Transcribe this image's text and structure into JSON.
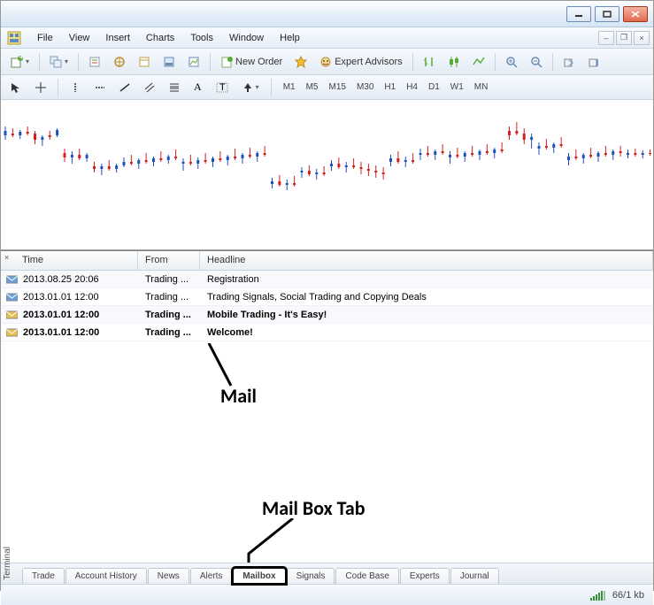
{
  "menu": {
    "file": "File",
    "view": "View",
    "insert": "Insert",
    "charts": "Charts",
    "tools": "Tools",
    "window": "Window",
    "help": "Help"
  },
  "toolbar": {
    "new_order": "New Order",
    "expert_advisors": "Expert Advisors"
  },
  "timeframes": [
    "M1",
    "M5",
    "M15",
    "M30",
    "H1",
    "H4",
    "D1",
    "W1",
    "MN"
  ],
  "mail": {
    "columns": {
      "time": "Time",
      "from": "From",
      "headline": "Headline"
    },
    "rows": [
      {
        "time": "2013.08.25 20:06",
        "from": "Trading ...",
        "headline": "Registration",
        "read": true
      },
      {
        "time": "2013.01.01 12:00",
        "from": "Trading ...",
        "headline": "Trading Signals, Social Trading and Copying Deals",
        "read": true
      },
      {
        "time": "2013.01.01 12:00",
        "from": "Trading ...",
        "headline": "Mobile Trading - It's Easy!",
        "read": false
      },
      {
        "time": "2013.01.01 12:00",
        "from": "Trading ...",
        "headline": "Welcome!",
        "read": false
      }
    ]
  },
  "tabs": [
    "Trade",
    "Account History",
    "News",
    "Alerts",
    "Mailbox",
    "Signals",
    "Code Base",
    "Experts",
    "Journal"
  ],
  "active_tab": "Mailbox",
  "terminal_label": "Terminal",
  "status": {
    "conn": "66/1 kb"
  },
  "annotations": {
    "mail": "Mail",
    "mailbox_tab": "Mail Box Tab"
  }
}
